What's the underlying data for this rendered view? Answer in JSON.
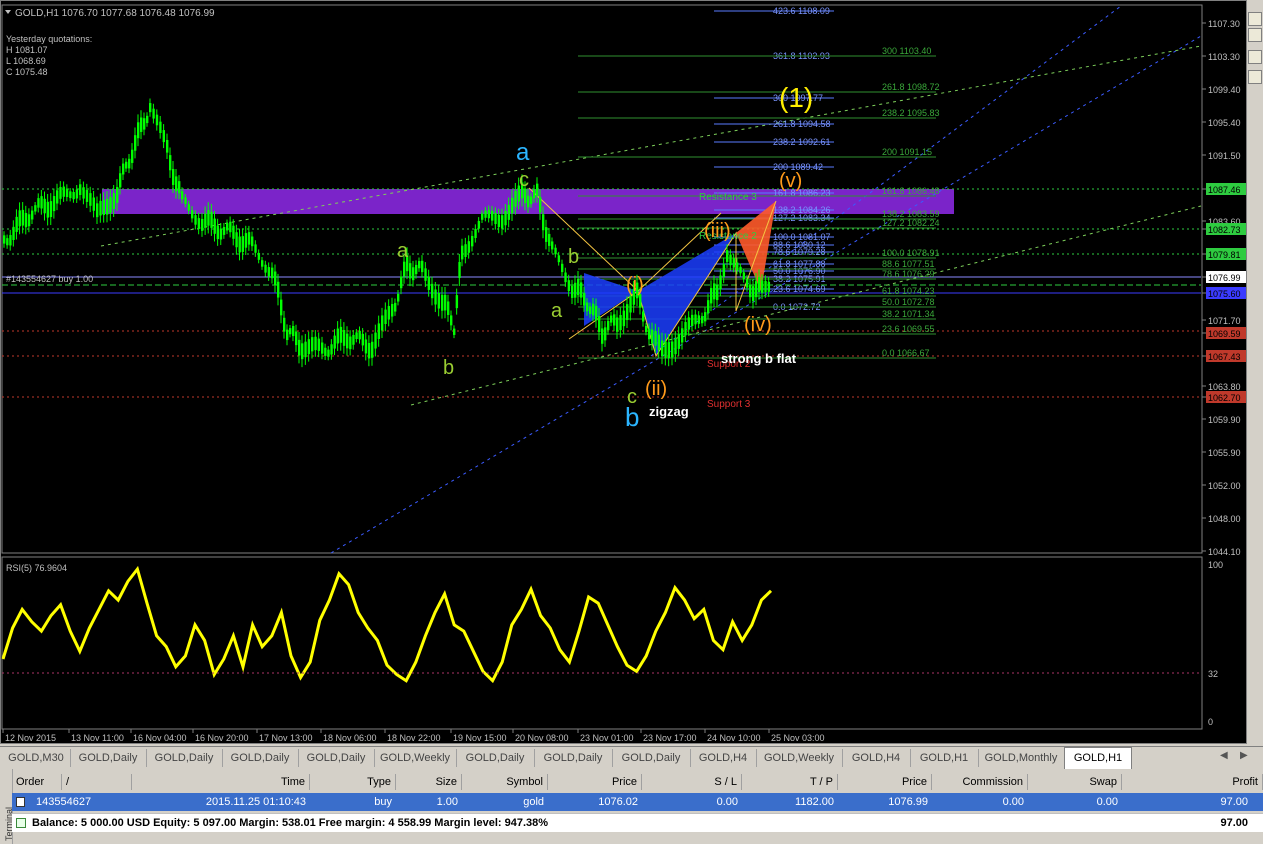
{
  "chart": {
    "symbol_header": "GOLD,H1  1076.70 1077.68 1076.48 1076.99",
    "yesterday": {
      "title": "Yesterday quotations:",
      "high": "H 1081.07",
      "low": "L 1068.69",
      "close": "C 1075.48"
    },
    "price_axis": [
      "1107.30",
      "1103.30",
      "1099.40",
      "1095.40",
      "1091.50",
      "1087.46",
      "1083.60",
      "1082.73",
      "1079.81",
      "1076.99",
      "1075.60",
      "1071.70",
      "1069.59",
      "1067.43",
      "1063.80",
      "1062.70",
      "1059.90",
      "1055.90",
      "1052.00",
      "1048.00",
      "1044.10"
    ],
    "time_axis": [
      "12 Nov 2015",
      "13 Nov 11:00",
      "16 Nov 04:00",
      "16 Nov 20:00",
      "17 Nov 13:00",
      "18 Nov 06:00",
      "18 Nov 22:00",
      "19 Nov 15:00",
      "20 Nov 08:00",
      "23 Nov 01:00",
      "23 Nov 17:00",
      "24 Nov 10:00",
      "25 Nov 03:00"
    ],
    "order_line_label": "#143554627 buy 1.00",
    "levels": {
      "resistance3": "Resistance 3",
      "resistance2": "Resistance 2",
      "support2": "Support 2",
      "support3": "Support 3"
    },
    "fib_blue": [
      "423.6  1108.09",
      "361.8  1102.93",
      "300  1097.77",
      "261.8  1094.58",
      "238.2  1092.61",
      "200  1089.42",
      "161.8  1086.23",
      "138.2  1084.26",
      "127.2  1083.34",
      "100.0  1081.07",
      "88.6  1080.12",
      "78.6  1079.28",
      "61.8  1077.88",
      "50.0  1076.90",
      "38.2  1075.91",
      "23.6  1074.69",
      "0.0  1072.72"
    ],
    "fib_green": [
      "300  1103.40",
      "261.8  1098.72",
      "238.2  1095.83",
      "200  1091.15",
      "161.8  1086.48",
      "138.2  1083.59",
      "127.2  1082.24",
      "100.0  1078.91",
      "88.6  1077.51",
      "78.6  1076.29",
      "61.8  1074.23",
      "50.0  1072.78",
      "38.2  1071.34",
      "23.6  1069.55",
      "0.0  1066.67"
    ],
    "wave_labels": {
      "major_1": "(1)",
      "a_top": "a",
      "c_top": "c",
      "a_left": "a",
      "b_left": "b",
      "b_mid": "b",
      "a_mid": "a",
      "i": "(i)",
      "ii": "(ii)",
      "c_bottom": "c",
      "b_bottom": "b",
      "iii": "(iii)",
      "iv": "(iv)",
      "v": "(v)",
      "zigzag": "zigzag",
      "strong_b_flat": "strong b flat"
    },
    "rsi": {
      "title": "RSI(5) 76.9604",
      "scale": [
        "100",
        "32",
        "0"
      ]
    },
    "colors": {
      "background": "#000000",
      "candles": "#00ff00",
      "rsi_line": "#ffff00",
      "resistance_zone": "#7b24c9",
      "pattern_fill": "#1b3dff",
      "fib_blue": "#5a7bff",
      "fib_green": "#2f8f2f"
    }
  },
  "tabs": [
    "GOLD,M30",
    "GOLD,Daily",
    "GOLD,Daily",
    "GOLD,Daily",
    "GOLD,Daily",
    "GOLD,Weekly",
    "GOLD,Daily",
    "GOLD,Daily",
    "GOLD,Daily",
    "GOLD,H4",
    "GOLD,Weekly",
    "GOLD,H4",
    "GOLD,H1",
    "GOLD,Monthly",
    "GOLD,H1"
  ],
  "active_tab_index": 14,
  "terminal": {
    "side_label": "Terminal",
    "headers": [
      "Order",
      "/",
      "Time",
      "Type",
      "Size",
      "Symbol",
      "Price",
      "S / L",
      "T / P",
      "Price",
      "Commission",
      "Swap",
      "Profit"
    ],
    "order": {
      "order": "143554627",
      "time": "2015.11.25 01:10:43",
      "type": "buy",
      "size": "1.00",
      "symbol": "gold",
      "price": "1076.02",
      "sl": "0.00",
      "tp": "1182.00",
      "current_price": "1076.99",
      "commission": "0.00",
      "swap": "0.00",
      "profit": "97.00"
    },
    "balance_line": "Balance: 5 000.00 USD  Equity: 5 097.00  Margin: 538.01  Free margin: 4 558.99  Margin level: 947.38%",
    "balance_profit": "97.00"
  }
}
